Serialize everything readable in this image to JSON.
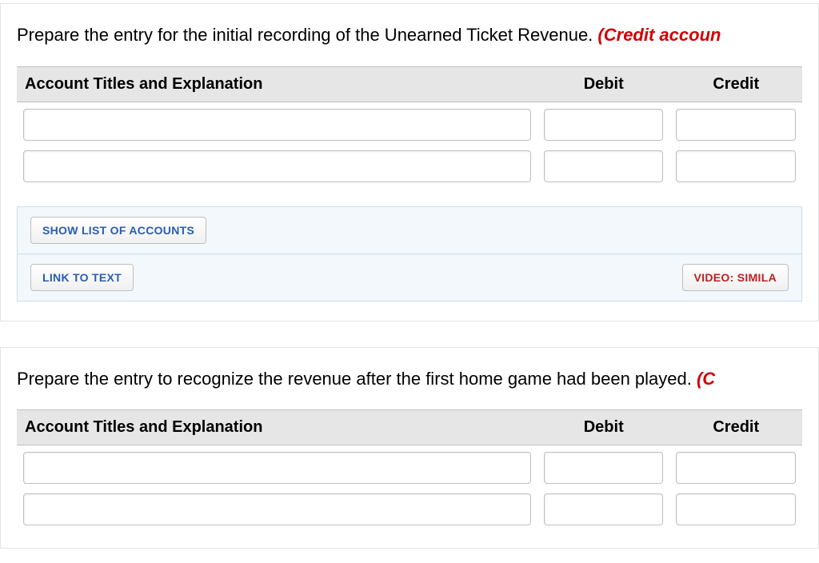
{
  "section1": {
    "prompt_plain": "Prepare the entry for the initial recording of the Unearned Ticket Revenue. ",
    "prompt_red": "(Credit accoun",
    "th_account": "Account Titles and Explanation",
    "th_debit": "Debit",
    "th_credit": "Credit",
    "rows": [
      {
        "account": "",
        "debit": "",
        "credit": ""
      },
      {
        "account": "",
        "debit": "",
        "credit": ""
      }
    ],
    "btn_show_accounts": "SHOW LIST OF ACCOUNTS",
    "btn_link_text": "LINK TO TEXT",
    "btn_video": "VIDEO: SIMILA"
  },
  "section2": {
    "prompt_plain": "Prepare the entry to recognize the revenue after the first home game had been played. ",
    "prompt_red": "(C",
    "th_account": "Account Titles and Explanation",
    "th_debit": "Debit",
    "th_credit": "Credit",
    "rows": [
      {
        "account": "",
        "debit": "",
        "credit": ""
      },
      {
        "account": "",
        "debit": "",
        "credit": ""
      }
    ]
  }
}
